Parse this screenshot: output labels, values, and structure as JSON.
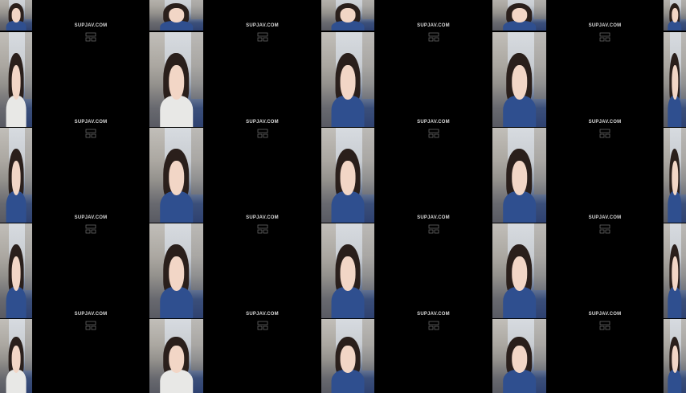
{
  "watermark": "SUPJAV.COM",
  "colors": {
    "background": "#000000",
    "jacket": "#2f4f8f",
    "shirt": "#e8e8e6",
    "hair": "#2a1f1b",
    "skin": "#f2d6c6"
  },
  "grid": {
    "columns": 9,
    "rows": 5,
    "description_icon": "watermark-emblem-icon"
  }
}
